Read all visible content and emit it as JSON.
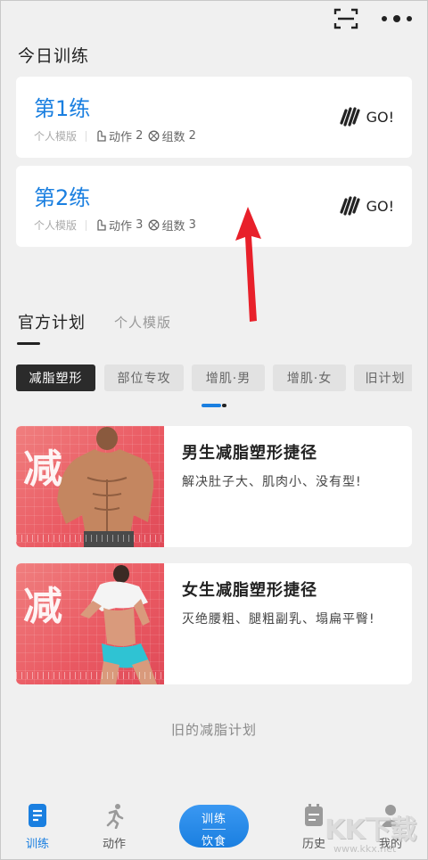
{
  "header": {
    "section_title": "今日训练"
  },
  "workouts": [
    {
      "title": "第1练",
      "template": "个人模版",
      "actions_label": "动作",
      "actions_count": "2",
      "sets_label": "组数",
      "sets_count": "2",
      "go_label": "GO!"
    },
    {
      "title": "第2练",
      "template": "个人模版",
      "actions_label": "动作",
      "actions_count": "3",
      "sets_label": "组数",
      "sets_count": "3",
      "go_label": "GO!"
    }
  ],
  "plan_tabs": [
    {
      "label": "官方计划",
      "active": true
    },
    {
      "label": "个人模版",
      "active": false
    }
  ],
  "categories": [
    {
      "label": "减脂塑形",
      "active": true
    },
    {
      "label": "部位专攻",
      "active": false
    },
    {
      "label": "增肌·男",
      "active": false
    },
    {
      "label": "增肌·女",
      "active": false
    },
    {
      "label": "旧计划",
      "active": false
    }
  ],
  "plans": [
    {
      "badge": "减",
      "title": "男生减脂塑形捷径",
      "desc": "解决肚子大、肌肉小、没有型!"
    },
    {
      "badge": "减",
      "title": "女生减脂塑形捷径",
      "desc": "灭绝腰粗、腿粗副乳、塌扁平臀!"
    }
  ],
  "old_plans_link": "旧的减脂计划",
  "bottom_nav": {
    "items": [
      {
        "label": "训练",
        "icon": "document-icon",
        "active": true
      },
      {
        "label": "动作",
        "icon": "running-icon",
        "active": false
      },
      {
        "label_line1": "训练",
        "label_line2": "饮食"
      },
      {
        "label": "历史",
        "icon": "calendar-icon",
        "active": false
      },
      {
        "label": "我的",
        "icon": "profile-icon",
        "active": false
      }
    ]
  },
  "watermark": {
    "text": "KK下载",
    "url": "www.kkx.net"
  },
  "colors": {
    "accent": "#1a7fe0",
    "chip_active": "#2b2b2b",
    "plan_image": "#ea5a63",
    "arrow": "#e8202a"
  }
}
